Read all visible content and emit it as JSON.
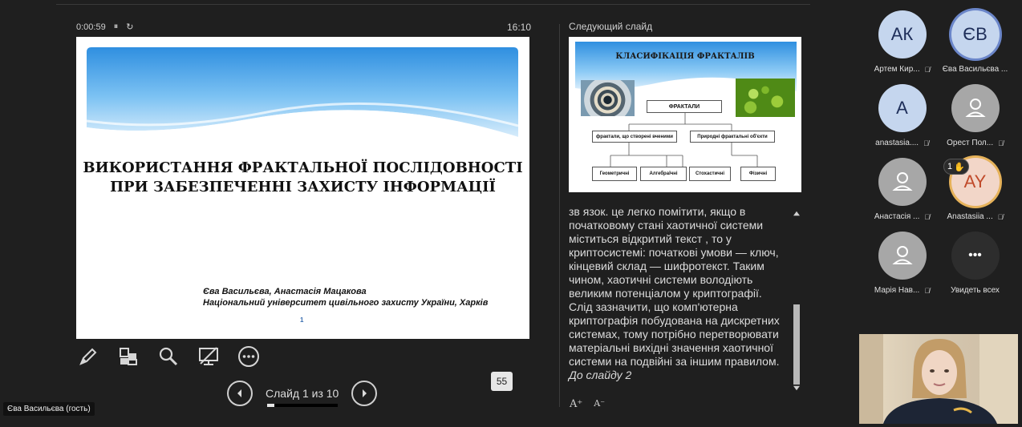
{
  "presenter": {
    "elapsed": "0:00:59",
    "pause_icon": "⏸",
    "reset_icon": "↻",
    "clock": "16:10"
  },
  "current_slide": {
    "title_line1": "ВИКОРИСТАННЯ ФРАКТАЛЬНОЇ ПОСЛІДОВНОСТІ",
    "title_line2": "ПРИ ЗАБЕЗПЕЧЕННІ ЗАХИСТУ ІНФОРМАЦІЇ",
    "authors_line1": "Єва Васильєва, Анастасія Мацакова",
    "authors_line2": "Національний університет цивільного захисту України, Харків",
    "page_number": "1"
  },
  "navigation": {
    "label": "Слайд 1 из 10",
    "progress_fraction": 0.1
  },
  "slide_badge": "55",
  "next_slide": {
    "label": "Следующий слайд",
    "title": "КЛАСИФІКАЦІЯ ФРАКТАЛІВ",
    "root": "ФРАКТАЛИ",
    "branch_left": "фрактали, що створені вченими",
    "branch_right": "Природні фрактальні об'єкти",
    "leaf1": "Геометричні",
    "leaf2": "Алгебраїчні",
    "leaf3": "Стохастичні",
    "leaf4": "Фізичні"
  },
  "notes": {
    "text": "зв язок. це легко помітити, якщо в початковому стані хаотичної системи міститься відкритий текст , то у криптосистемі: початкові умови — ключ, кінцевий склад — шифротекст. Таким чином, хаотичні системи володіють великим потенціалом у криптографії. Слід зазначити, що комп'ютерна криптографія побудована на дискретних системах, тому потрібно перетворювати матеріальні вихідні значення хаотичної системи на подвійні за іншим правилом.",
    "next_link": "До слайду 2"
  },
  "font_buttons": {
    "increase": "A⁺",
    "decrease": "A⁻"
  },
  "participants": [
    {
      "initials": "АК",
      "name": "Артем Кир..."
    },
    {
      "initials": "ЄВ",
      "name": "Єва Васильєва ..."
    },
    {
      "initials": "A",
      "name": "anastasia...."
    },
    {
      "initials": "",
      "name": "Орест Пол..."
    },
    {
      "initials": "",
      "name": "Анастасія ..."
    },
    {
      "initials": "AY",
      "name": "Anastasiia ..."
    },
    {
      "initials": "",
      "name": "Марія Нав..."
    },
    {
      "initials": "•••",
      "name": "Увидеть всех"
    }
  ],
  "raised_hand": {
    "count": "1",
    "icon": "✋"
  },
  "guest_label": "Єва Васильєва (гость)",
  "colors": {
    "background": "#1f1f1f",
    "avatar_initial": "#c5d6ee",
    "avatar_person": "#a7a7a7",
    "avatar_highlight": "#f2d6c8"
  }
}
